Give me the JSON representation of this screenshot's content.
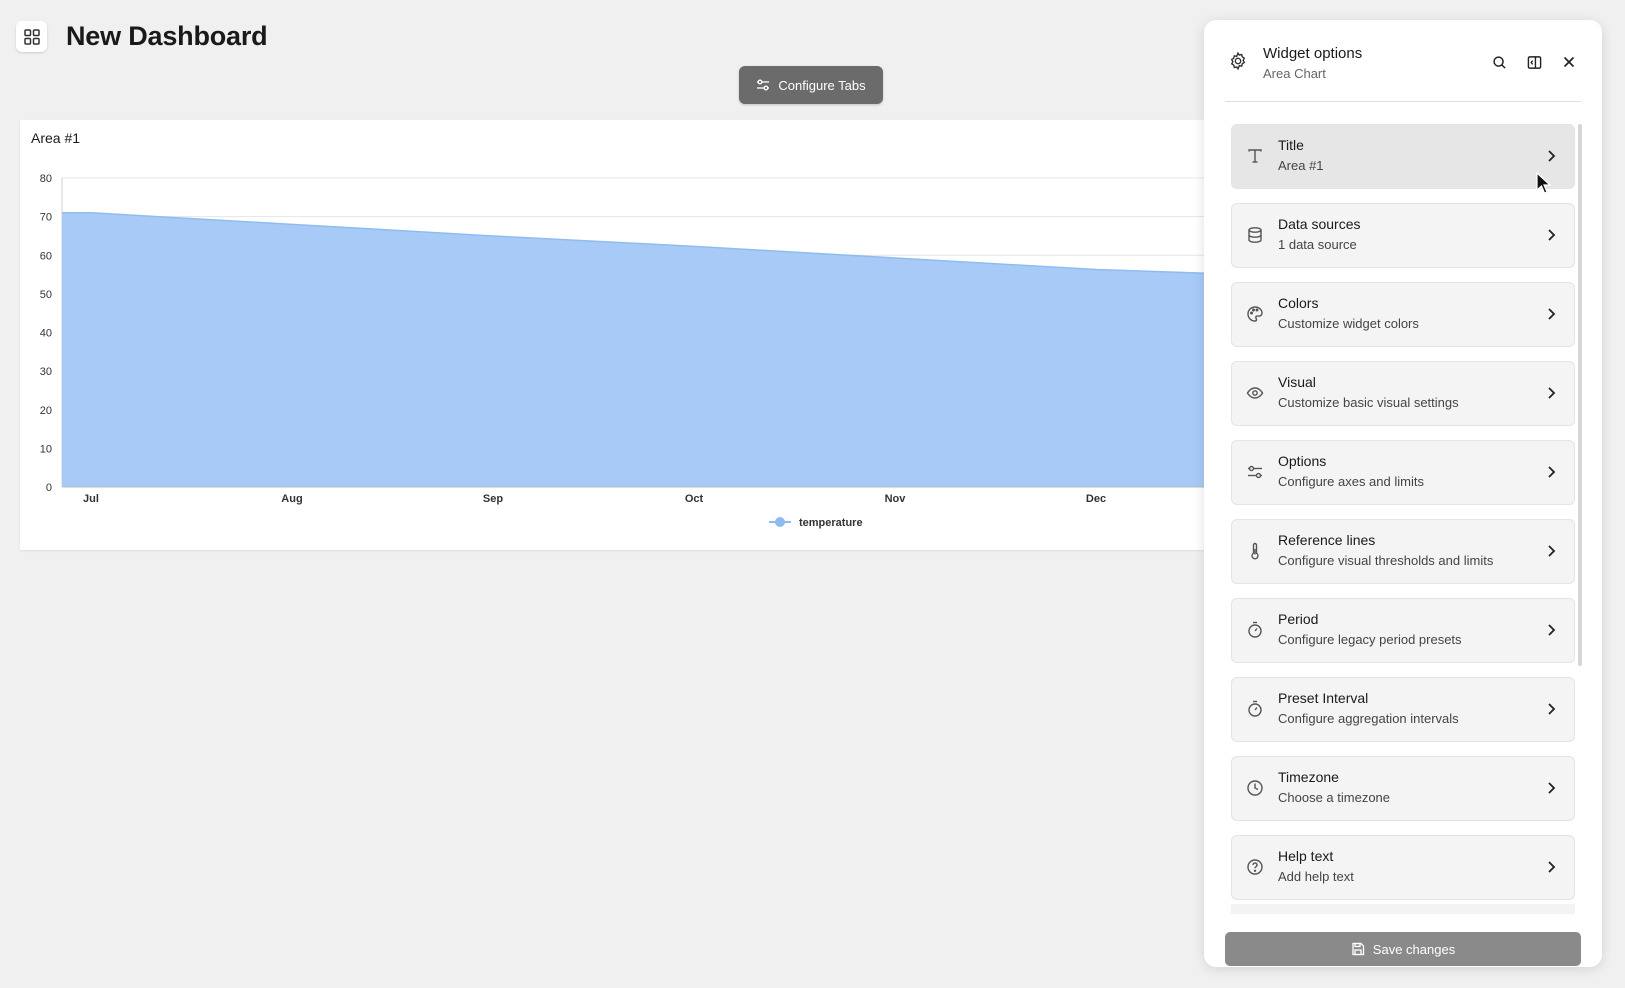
{
  "header": {
    "title": "New Dashboard",
    "grid_icon": "grid-icon"
  },
  "toolbar": {
    "configure_tabs_label": "Configure Tabs",
    "configure_icon": "sliders-icon"
  },
  "widget": {
    "title": "Area #1"
  },
  "chart_data": {
    "type": "area",
    "categories": [
      "Jul",
      "Aug",
      "Sep",
      "Oct",
      "Nov",
      "Dec"
    ],
    "series": [
      {
        "name": "temperature",
        "values": [
          71,
          68,
          65,
          62.3,
          59.3,
          56.3
        ],
        "color": "#a7cbf6"
      }
    ],
    "yticks": [
      0,
      10,
      20,
      30,
      40,
      50,
      60,
      70,
      80
    ],
    "ylim": [
      0,
      80
    ],
    "legend_position": "bottom",
    "grid": true
  },
  "panel": {
    "title": "Widget options",
    "subtitle": "Area Chart",
    "icons": {
      "settings": "gear-icon",
      "search": "search-icon",
      "split": "panel-toggle-icon",
      "close": "close-icon"
    },
    "items": [
      {
        "label": "Title",
        "desc": "Area #1",
        "icon": "text-icon"
      },
      {
        "label": "Data sources",
        "desc": "1 data source",
        "icon": "database-icon"
      },
      {
        "label": "Colors",
        "desc": "Customize widget colors",
        "icon": "palette-icon"
      },
      {
        "label": "Visual",
        "desc": "Customize basic visual settings",
        "icon": "eye-icon"
      },
      {
        "label": "Options",
        "desc": "Configure axes and limits",
        "icon": "sliders-icon"
      },
      {
        "label": "Reference lines",
        "desc": "Configure visual thresholds and limits",
        "icon": "thermometer-icon"
      },
      {
        "label": "Period",
        "desc": "Configure legacy period presets",
        "icon": "timer-icon"
      },
      {
        "label": "Preset Interval",
        "desc": "Configure aggregation intervals",
        "icon": "timer-icon"
      },
      {
        "label": "Timezone",
        "desc": "Choose a timezone",
        "icon": "clock-icon"
      },
      {
        "label": "Help text",
        "desc": "Add help text",
        "icon": "help-circle-icon"
      }
    ],
    "save_label": "Save changes"
  }
}
